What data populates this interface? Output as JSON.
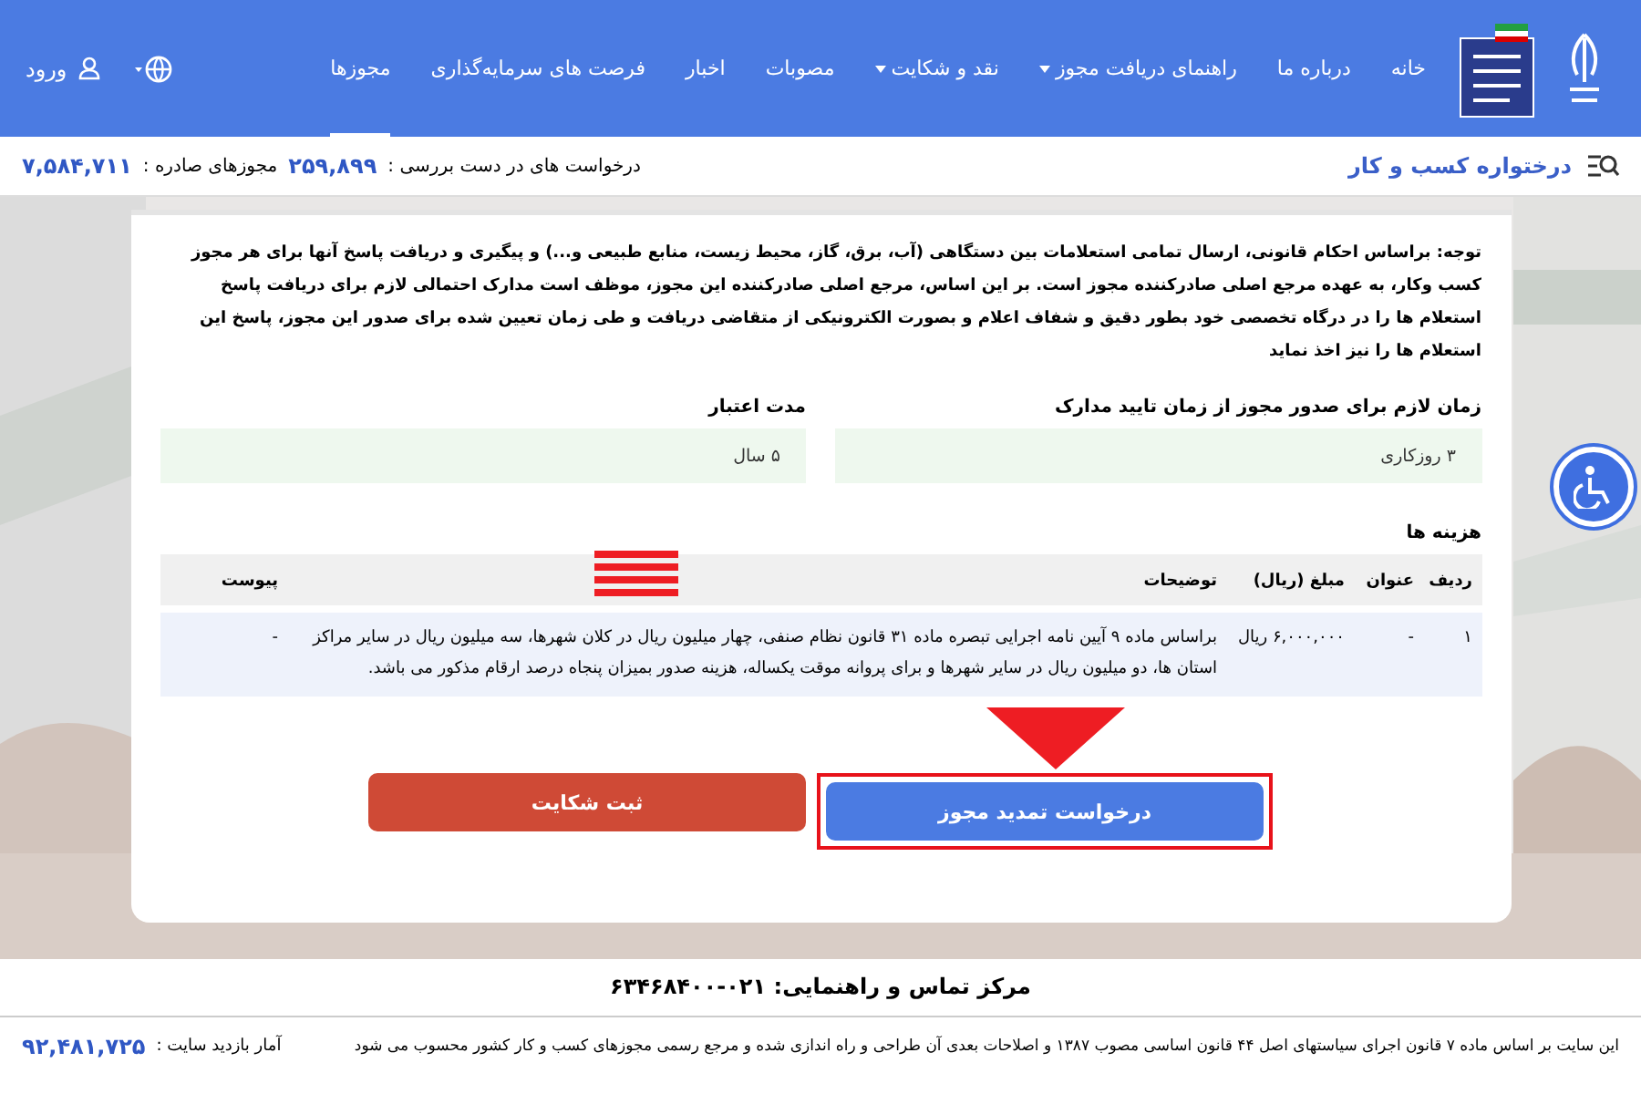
{
  "header": {
    "nav": [
      {
        "label": "خانه",
        "selected": false,
        "dropdown": false
      },
      {
        "label": "درباره ما",
        "selected": false,
        "dropdown": false
      },
      {
        "label": "راهنمای دریافت مجوز",
        "selected": false,
        "dropdown": true
      },
      {
        "label": "نقد و شکایت",
        "selected": false,
        "dropdown": true
      },
      {
        "label": "مصوبات",
        "selected": false,
        "dropdown": false
      },
      {
        "label": "اخبار",
        "selected": false,
        "dropdown": false
      },
      {
        "label": "فرصت های سرمایه‌گذاری",
        "selected": false,
        "dropdown": false
      },
      {
        "label": "مجوزها",
        "selected": true,
        "dropdown": false
      }
    ],
    "login": "ورود"
  },
  "info_bar": {
    "title": "درختواره کسب و کار",
    "pending_label": "درخواست های در دست بررسی :",
    "pending": "۲۵۹,۸۹۹",
    "issued_label": "مجوزهای صادره :",
    "issued": "۷,۵۸۴,۷۱۱"
  },
  "notice": "توجه: براساس احکام قانونی، ارسال تمامی استعلامات بین دستگاهی (آب، برق، گاز، محیط زیست، منابع طبیعی و...) و پیگیری و دریافت پاسخ آنها برای هر مجوز کسب وکار، به عهده مرجع اصلی صادرکننده مجوز است. بر این اساس، مرجع اصلی صادرکننده این مجوز، موظف است مدارک احتمالی لازم برای دریافت پاسخ استعلام ها را در درگاه تخصصی خود بطور دقیق و شفاف اعلام و بصورت الکترونیکی از متقاضی دریافت و طی زمان تعیین شده برای صدور این مجوز، پاسخ این استعلام ها را نیز اخذ نماید",
  "fields": [
    {
      "label": "زمان لازم برای صدور مجوز از زمان تایید مدارک",
      "value": "۳ روزکاری"
    },
    {
      "label": "مدت اعتبار",
      "value": "۵ سال"
    }
  ],
  "costs": {
    "title": "هزینه ها",
    "columns": [
      "ردیف",
      "عنوان",
      "مبلغ (ریال)",
      "توضیحات",
      "پیوست"
    ],
    "rows": [
      [
        "۱",
        "-",
        "۶,۰۰۰,۰۰۰ ریال",
        "براساس ماده ۹ آیین نامه اجرایی تبصره ماده ۳۱ قانون نظام صنفی، چهار میلیون ریال در کلان شهرها، سه میلیون ریال در سایر مراکز استان ها، دو میلیون ریال در سایر شهرها و برای پروانه موقت یکساله، هزینه صدور بمیزان پنجاه درصد ارقام مذکور می باشد.",
        "-"
      ]
    ]
  },
  "buttons": [
    {
      "label": "درخواست تمدید مجوز",
      "kind": "primary",
      "highlighted": true
    },
    {
      "label": "ثبت شکایت",
      "kind": "danger",
      "highlighted": false
    }
  ],
  "footer": {
    "contact": "مرکز تماس و راهنمایی: ۰۲۱-۶۳۴۶۸۴۰۰",
    "note": "این سایت بر اساس ماده ۷ قانون اجرای سیاستهای اصل ۴۴ قانون اساسی مصوب ۱۳۸۷ و اصلاحات بعدی آن طراحی و راه اندازی شده و مرجع رسمی مجوزهای کسب و کار کشور محسوب می شود",
    "visits_label": "آمار بازدید سایت :",
    "visits": "۹۲,۴۸۱,۷۲۵"
  }
}
